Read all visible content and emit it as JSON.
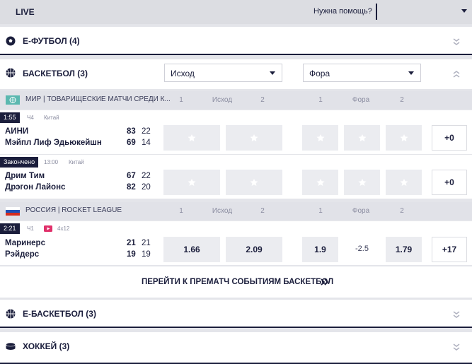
{
  "header": {
    "live": "LIVE",
    "help": "Нужна помощь?"
  },
  "sports": {
    "efootball": "Е-ФУТБОЛ (4)",
    "basketball": "БАСКЕТБОЛ (3)",
    "ebasketball": "Е-БАСКЕТБОЛ (3)",
    "hockey": "ХОККЕЙ (3)"
  },
  "selects": {
    "outcome": "Исход",
    "handicap": "Фора"
  },
  "leagues": [
    {
      "name": "МИР | ТОВАРИЩЕСКИЕ МАТЧИ СРЕДИ К...",
      "h1": "1",
      "h2": "Исход",
      "h3": "2",
      "h4": "1",
      "h5": "Фора",
      "h6": "2"
    },
    {
      "name": "РОССИЯ | ROCKET LEAGUE",
      "h1": "1",
      "h2": "Исход",
      "h3": "2",
      "h4": "1",
      "h5": "Фора",
      "h6": "2"
    }
  ],
  "matches": [
    {
      "status": "1:55",
      "period": "Ч4",
      "country": "Китай",
      "team1": "АИНИ",
      "team2": "Мэйпл Лиф Эдьюкейшн",
      "s1": "83",
      "p1": "22",
      "s2": "69",
      "p2": "14",
      "more": "+0"
    },
    {
      "status": "Закончено",
      "time": "13:00",
      "country": "Китай",
      "team1": "Дрим Тим",
      "team2": "Дрэгон Лайонс",
      "s1": "67",
      "p1": "22",
      "s2": "82",
      "p2": "20",
      "more": "+0"
    },
    {
      "status": "2:21",
      "period": "Ч1",
      "format": "4x12",
      "team1": "Маринерс",
      "team2": "Рэйдерс",
      "s1": "21",
      "p1": "21",
      "s2": "19",
      "p2": "19",
      "o1": "1.66",
      "o2": "2.09",
      "h1": "1.9",
      "hval": "-2.5",
      "h2": "1.79",
      "more": "+17"
    }
  ],
  "prematch": "ПЕРЕЙТИ К ПРЕМАТЧ СОБЫТИЯМ БАСКЕТБОЛ",
  "colors": {
    "navy": "#1b1e3c",
    "bg": "#e4e5ea",
    "oddbg": "#ebecf0"
  }
}
